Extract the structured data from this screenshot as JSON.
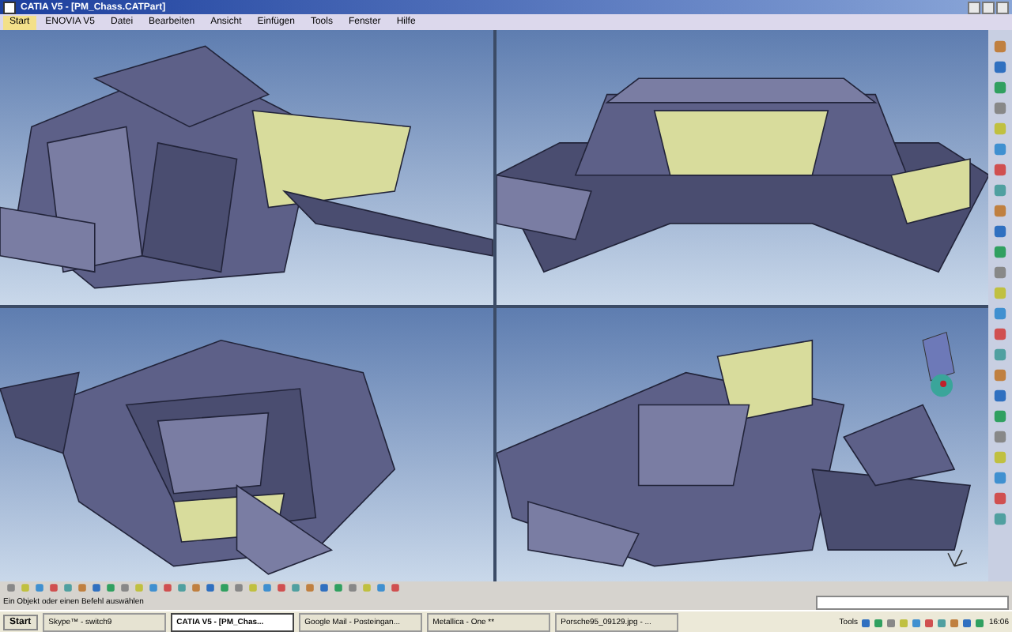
{
  "window": {
    "title": "CATIA V5 - [PM_Chass.CATPart]"
  },
  "menu": [
    {
      "label": "Start",
      "selected": true
    },
    {
      "label": "ENOVIA V5",
      "selected": false
    },
    {
      "label": "Datei",
      "selected": false
    },
    {
      "label": "Bearbeiten",
      "selected": false
    },
    {
      "label": "Ansicht",
      "selected": false
    },
    {
      "label": "Einfügen",
      "selected": false
    },
    {
      "label": "Tools",
      "selected": false
    },
    {
      "label": "Fenster",
      "selected": false
    },
    {
      "label": "Hilfe",
      "selected": false
    }
  ],
  "status_bar": {
    "text": "Ein Objekt oder einen Befehl auswählen"
  },
  "taskbar": {
    "start": "Start",
    "tasks": [
      {
        "label": "Skype™ - switch9",
        "selected": false
      },
      {
        "label": "CATIA V5 - [PM_Chas...",
        "selected": true
      },
      {
        "label": "Google Mail - Posteingan...",
        "selected": false
      },
      {
        "label": "Metallica - One **",
        "selected": false
      },
      {
        "label": "Porsche95_09129.jpg - ...",
        "selected": false
      }
    ],
    "toolbar_label": "Tools",
    "time": "16:06"
  }
}
